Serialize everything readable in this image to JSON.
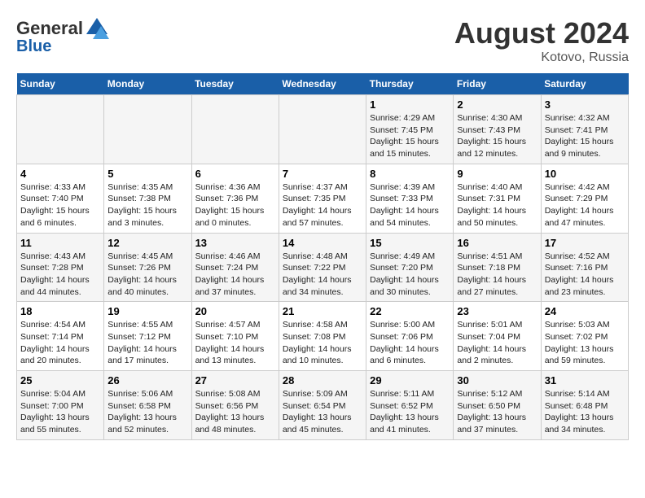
{
  "header": {
    "logo_general": "General",
    "logo_blue": "Blue",
    "title": "August 2024",
    "subtitle": "Kotovo, Russia"
  },
  "days_of_week": [
    "Sunday",
    "Monday",
    "Tuesday",
    "Wednesday",
    "Thursday",
    "Friday",
    "Saturday"
  ],
  "weeks": [
    [
      {
        "num": "",
        "info": ""
      },
      {
        "num": "",
        "info": ""
      },
      {
        "num": "",
        "info": ""
      },
      {
        "num": "",
        "info": ""
      },
      {
        "num": "1",
        "info": "Sunrise: 4:29 AM\nSunset: 7:45 PM\nDaylight: 15 hours and 15 minutes."
      },
      {
        "num": "2",
        "info": "Sunrise: 4:30 AM\nSunset: 7:43 PM\nDaylight: 15 hours and 12 minutes."
      },
      {
        "num": "3",
        "info": "Sunrise: 4:32 AM\nSunset: 7:41 PM\nDaylight: 15 hours and 9 minutes."
      }
    ],
    [
      {
        "num": "4",
        "info": "Sunrise: 4:33 AM\nSunset: 7:40 PM\nDaylight: 15 hours and 6 minutes."
      },
      {
        "num": "5",
        "info": "Sunrise: 4:35 AM\nSunset: 7:38 PM\nDaylight: 15 hours and 3 minutes."
      },
      {
        "num": "6",
        "info": "Sunrise: 4:36 AM\nSunset: 7:36 PM\nDaylight: 15 hours and 0 minutes."
      },
      {
        "num": "7",
        "info": "Sunrise: 4:37 AM\nSunset: 7:35 PM\nDaylight: 14 hours and 57 minutes."
      },
      {
        "num": "8",
        "info": "Sunrise: 4:39 AM\nSunset: 7:33 PM\nDaylight: 14 hours and 54 minutes."
      },
      {
        "num": "9",
        "info": "Sunrise: 4:40 AM\nSunset: 7:31 PM\nDaylight: 14 hours and 50 minutes."
      },
      {
        "num": "10",
        "info": "Sunrise: 4:42 AM\nSunset: 7:29 PM\nDaylight: 14 hours and 47 minutes."
      }
    ],
    [
      {
        "num": "11",
        "info": "Sunrise: 4:43 AM\nSunset: 7:28 PM\nDaylight: 14 hours and 44 minutes."
      },
      {
        "num": "12",
        "info": "Sunrise: 4:45 AM\nSunset: 7:26 PM\nDaylight: 14 hours and 40 minutes."
      },
      {
        "num": "13",
        "info": "Sunrise: 4:46 AM\nSunset: 7:24 PM\nDaylight: 14 hours and 37 minutes."
      },
      {
        "num": "14",
        "info": "Sunrise: 4:48 AM\nSunset: 7:22 PM\nDaylight: 14 hours and 34 minutes."
      },
      {
        "num": "15",
        "info": "Sunrise: 4:49 AM\nSunset: 7:20 PM\nDaylight: 14 hours and 30 minutes."
      },
      {
        "num": "16",
        "info": "Sunrise: 4:51 AM\nSunset: 7:18 PM\nDaylight: 14 hours and 27 minutes."
      },
      {
        "num": "17",
        "info": "Sunrise: 4:52 AM\nSunset: 7:16 PM\nDaylight: 14 hours and 23 minutes."
      }
    ],
    [
      {
        "num": "18",
        "info": "Sunrise: 4:54 AM\nSunset: 7:14 PM\nDaylight: 14 hours and 20 minutes."
      },
      {
        "num": "19",
        "info": "Sunrise: 4:55 AM\nSunset: 7:12 PM\nDaylight: 14 hours and 17 minutes."
      },
      {
        "num": "20",
        "info": "Sunrise: 4:57 AM\nSunset: 7:10 PM\nDaylight: 14 hours and 13 minutes."
      },
      {
        "num": "21",
        "info": "Sunrise: 4:58 AM\nSunset: 7:08 PM\nDaylight: 14 hours and 10 minutes."
      },
      {
        "num": "22",
        "info": "Sunrise: 5:00 AM\nSunset: 7:06 PM\nDaylight: 14 hours and 6 minutes."
      },
      {
        "num": "23",
        "info": "Sunrise: 5:01 AM\nSunset: 7:04 PM\nDaylight: 14 hours and 2 minutes."
      },
      {
        "num": "24",
        "info": "Sunrise: 5:03 AM\nSunset: 7:02 PM\nDaylight: 13 hours and 59 minutes."
      }
    ],
    [
      {
        "num": "25",
        "info": "Sunrise: 5:04 AM\nSunset: 7:00 PM\nDaylight: 13 hours and 55 minutes."
      },
      {
        "num": "26",
        "info": "Sunrise: 5:06 AM\nSunset: 6:58 PM\nDaylight: 13 hours and 52 minutes."
      },
      {
        "num": "27",
        "info": "Sunrise: 5:08 AM\nSunset: 6:56 PM\nDaylight: 13 hours and 48 minutes."
      },
      {
        "num": "28",
        "info": "Sunrise: 5:09 AM\nSunset: 6:54 PM\nDaylight: 13 hours and 45 minutes."
      },
      {
        "num": "29",
        "info": "Sunrise: 5:11 AM\nSunset: 6:52 PM\nDaylight: 13 hours and 41 minutes."
      },
      {
        "num": "30",
        "info": "Sunrise: 5:12 AM\nSunset: 6:50 PM\nDaylight: 13 hours and 37 minutes."
      },
      {
        "num": "31",
        "info": "Sunrise: 5:14 AM\nSunset: 6:48 PM\nDaylight: 13 hours and 34 minutes."
      }
    ]
  ]
}
